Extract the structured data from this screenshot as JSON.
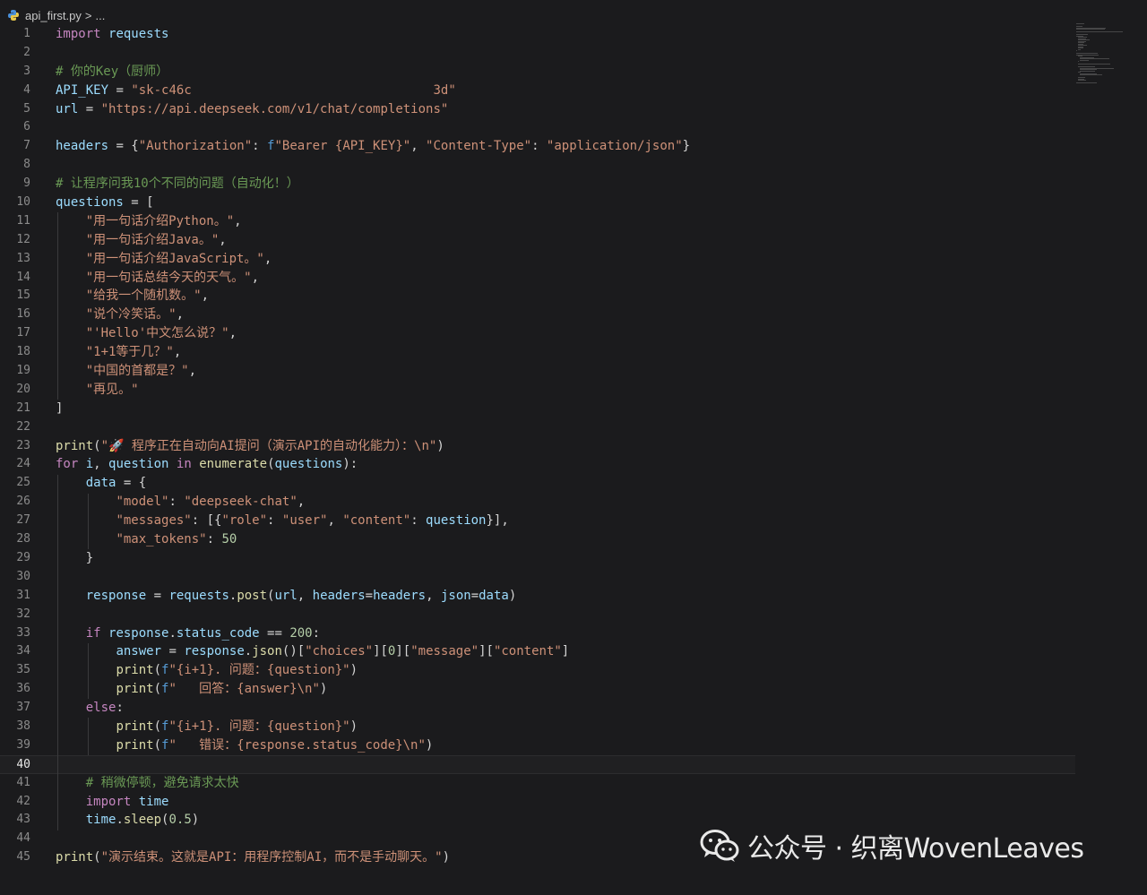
{
  "breadcrumb": {
    "file": "api_first.py",
    "separator": ">",
    "more": "..."
  },
  "code": {
    "current_line": 40,
    "lines": [
      {
        "n": "1",
        "t": "import requests"
      },
      {
        "n": "2",
        "t": ""
      },
      {
        "n": "3",
        "t": "# 你的Key（厨师）"
      },
      {
        "n": "4",
        "t": "API_KEY = \"sk-c46c                                3d\""
      },
      {
        "n": "5",
        "t": "url = \"https://api.deepseek.com/v1/chat/completions\""
      },
      {
        "n": "6",
        "t": ""
      },
      {
        "n": "7",
        "t": "headers = {\"Authorization\": f\"Bearer {API_KEY}\", \"Content-Type\": \"application/json\"}"
      },
      {
        "n": "8",
        "t": ""
      },
      {
        "n": "9",
        "t": "# 让程序问我10个不同的问题（自动化！）"
      },
      {
        "n": "10",
        "t": "questions = ["
      },
      {
        "n": "11",
        "t": "    \"用一句话介绍Python。\","
      },
      {
        "n": "12",
        "t": "    \"用一句话介绍Java。\","
      },
      {
        "n": "13",
        "t": "    \"用一句话介绍JavaScript。\","
      },
      {
        "n": "14",
        "t": "    \"用一句话总结今天的天气。\","
      },
      {
        "n": "15",
        "t": "    \"给我一个随机数。\","
      },
      {
        "n": "16",
        "t": "    \"说个冷笑话。\","
      },
      {
        "n": "17",
        "t": "    \"'Hello'中文怎么说？\","
      },
      {
        "n": "18",
        "t": "    \"1+1等于几？\","
      },
      {
        "n": "19",
        "t": "    \"中国的首都是？\","
      },
      {
        "n": "20",
        "t": "    \"再见。\""
      },
      {
        "n": "21",
        "t": "]"
      },
      {
        "n": "22",
        "t": ""
      },
      {
        "n": "23",
        "t": "print(\"🚀 程序正在自动向AI提问（演示API的自动化能力）：\\n\")"
      },
      {
        "n": "24",
        "t": "for i, question in enumerate(questions):"
      },
      {
        "n": "25",
        "t": "    data = {"
      },
      {
        "n": "26",
        "t": "        \"model\": \"deepseek-chat\","
      },
      {
        "n": "27",
        "t": "        \"messages\": [{\"role\": \"user\", \"content\": question}],"
      },
      {
        "n": "28",
        "t": "        \"max_tokens\": 50"
      },
      {
        "n": "29",
        "t": "    }"
      },
      {
        "n": "30",
        "t": ""
      },
      {
        "n": "31",
        "t": "    response = requests.post(url, headers=headers, json=data)"
      },
      {
        "n": "32",
        "t": ""
      },
      {
        "n": "33",
        "t": "    if response.status_code == 200:"
      },
      {
        "n": "34",
        "t": "        answer = response.json()[\"choices\"][0][\"message\"][\"content\"]"
      },
      {
        "n": "35",
        "t": "        print(f\"{i+1}. 问题：{question}\")"
      },
      {
        "n": "36",
        "t": "        print(f\"   回答：{answer}\\n\")"
      },
      {
        "n": "37",
        "t": "    else:"
      },
      {
        "n": "38",
        "t": "        print(f\"{i+1}. 问题：{question}\")"
      },
      {
        "n": "39",
        "t": "        print(f\"   错误：{response.status_code}\\n\")"
      },
      {
        "n": "40",
        "t": ""
      },
      {
        "n": "41",
        "t": "    # 稍微停顿，避免请求太快"
      },
      {
        "n": "42",
        "t": "    import time"
      },
      {
        "n": "43",
        "t": "    time.sleep(0.5)"
      },
      {
        "n": "44",
        "t": ""
      },
      {
        "n": "45",
        "t": "print(\"演示结束。这就是API：用程序控制AI，而不是手动聊天。\")"
      }
    ]
  },
  "watermark": {
    "icon": "wechat-icon",
    "text": "公众号 · 织离WovenLeaves"
  },
  "colors": {
    "background": "#1b1b1d",
    "keyword": "#c586c0",
    "variable": "#9cdcfe",
    "string": "#ce9178",
    "comment": "#6a9955",
    "number": "#b5cea8",
    "function": "#dcdcaa"
  }
}
